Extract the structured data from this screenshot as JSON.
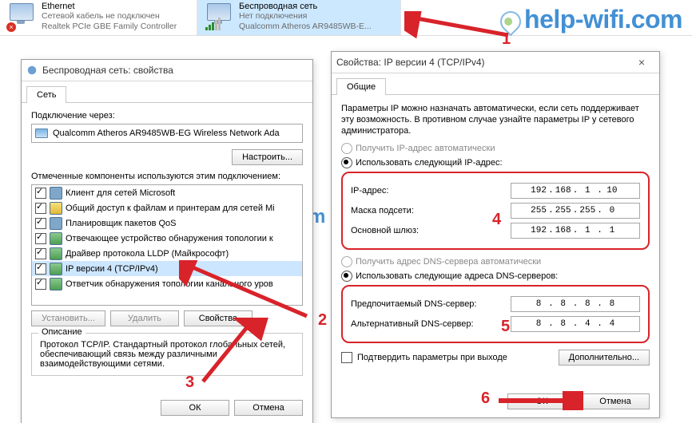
{
  "branding": {
    "text1": "help-",
    "text2": "wifi",
    "text3": ".com"
  },
  "top": {
    "eth": {
      "title": "Ethernet",
      "sub1": "Сетевой кабель не подключен",
      "sub2": "Realtek PCIe GBE Family Controller"
    },
    "wifi": {
      "title": "Беспроводная сеть",
      "sub1": "Нет подключения",
      "sub2": "Qualcomm Atheros AR9485WB-E..."
    }
  },
  "callouts": {
    "n1": "1",
    "n2": "2",
    "n3": "3",
    "n4": "4",
    "n5": "5",
    "n6": "6"
  },
  "props": {
    "title": "Беспроводная сеть: свойства",
    "tab": "Сеть",
    "connect_via": "Подключение через:",
    "adapter": "Qualcomm Atheros AR9485WB-EG Wireless Network Ada",
    "configure": "Настроить...",
    "components_label": "Отмеченные компоненты используются этим подключением:",
    "items": [
      "Клиент для сетей Microsoft",
      "Общий доступ к файлам и принтерам для сетей Мі",
      "Планировщик пакетов QoS",
      "Отвечающее устройство обнаружения топологии к",
      "Драйвер протокола LLDP (Майкрософт)",
      "IP версии 4 (TCP/IPv4)",
      "Ответчик обнаружения топологии канального уров"
    ],
    "install": "Установить...",
    "remove": "Удалить",
    "properties": "Свойства",
    "desc_title": "Описание",
    "desc_body": "Протокол TCP/IP. Стандартный протокол глобальных сетей, обеспечивающий связь между различными взаимодействующими сетями.",
    "ok": "ОК",
    "cancel": "Отмена"
  },
  "ipv4": {
    "title": "Свойства: IP версии 4 (TCP/IPv4)",
    "tab": "Общие",
    "para": "Параметры IP можно назначать автоматически, если сеть поддерживает эту возможность. В противном случае узнайте параметры IP у сетевого администратора.",
    "auto_ip": "Получить IP-адрес автоматически",
    "use_ip": "Использовать следующий IP-адрес:",
    "ip_label": "IP-адрес:",
    "ip_val": [
      "192",
      "168",
      "1",
      "10"
    ],
    "mask_label": "Маска подсети:",
    "mask_val": [
      "255",
      "255",
      "255",
      "0"
    ],
    "gw_label": "Основной шлюз:",
    "gw_val": [
      "192",
      "168",
      "1",
      "1"
    ],
    "auto_dns": "Получить адрес DNS-сервера автоматически",
    "use_dns": "Использовать следующие адреса DNS-серверов:",
    "dns1_label": "Предпочитаемый DNS-сервер:",
    "dns1_val": [
      "8",
      "8",
      "8",
      "8"
    ],
    "dns2_label": "Альтернативный DNS-сервер:",
    "dns2_val": [
      "8",
      "8",
      "4",
      "4"
    ],
    "validate": "Подтвердить параметры при выходе",
    "advanced": "Дополнительно...",
    "ok": "ОК",
    "cancel": "Отмена"
  }
}
